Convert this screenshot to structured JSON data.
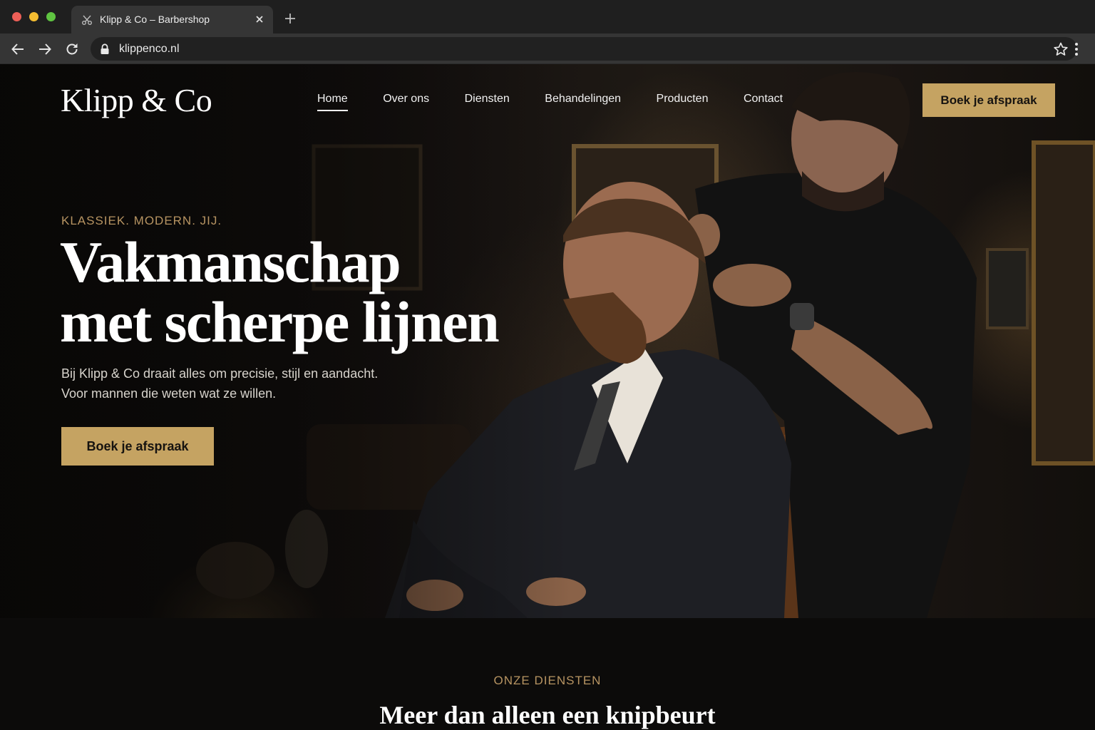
{
  "browser": {
    "tab_title": "Klipp & Co – Barbershop",
    "url": "klippenco.nl"
  },
  "site": {
    "logo": "Klipp & Co",
    "nav": [
      {
        "label": "Home",
        "active": true
      },
      {
        "label": "Over ons"
      },
      {
        "label": "Diensten"
      },
      {
        "label": "Behandelingen"
      },
      {
        "label": "Producten"
      },
      {
        "label": "Contact"
      }
    ],
    "cta_label": "Boek je afspraak"
  },
  "hero": {
    "kicker": "KLASSIEK. MODERN. JIJ.",
    "headline_line1": "Vakmanschap",
    "headline_line2": "met scherpe lijnen",
    "subtext_line1": "Bij Klipp & Co draait alles om precisie, stijl en aandacht.",
    "subtext_line2": "Voor mannen die weten wat ze willen.",
    "cta_label": "Boek je afspraak"
  },
  "services": {
    "kicker": "ONZE DIENSTEN",
    "title": "Meer dan alleen een knipbeurt"
  },
  "colors": {
    "accent_gold": "#c5a362",
    "kicker_gold": "#b79462",
    "background": "#0b0a09"
  }
}
